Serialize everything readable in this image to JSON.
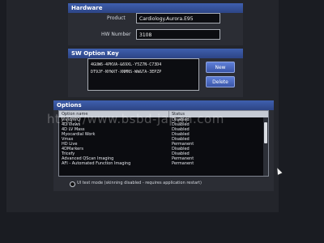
{
  "hardware": {
    "title": "Hardware",
    "product_label": "Product",
    "product_value": "Cardiology.Aurora.E95",
    "hw_number_label": "HW Number",
    "hw_number_value": "3108"
  },
  "sw_option_key": {
    "title": "SW Option Key",
    "keys": [
      "4GUW6-4PKVA-&69XL-Y5Z7N-C73D4",
      "DT9JF-NYWXT-XNMNS-WW&TA-3EPZP"
    ],
    "new_button": "New",
    "delete_button": "Delete"
  },
  "options": {
    "title": "Options",
    "columns": [
      "Option name",
      "Status"
    ],
    "rows": [
      {
        "name": "Vivid/WQ",
        "status": "Disabled"
      },
      {
        "name": "4D Views",
        "status": "Disabled"
      },
      {
        "name": "4D LV Mass",
        "status": "Disabled"
      },
      {
        "name": "Myocardial Work",
        "status": "Disabled"
      },
      {
        "name": "Vmax",
        "status": "Disabled"
      },
      {
        "name": "HD Live",
        "status": "Permanent"
      },
      {
        "name": "4DMarkers",
        "status": "Disabled"
      },
      {
        "name": "Tricefy",
        "status": "Disabled"
      },
      {
        "name": "Advanced QScan Imaging",
        "status": "Permanent"
      },
      {
        "name": "AFI - Automated Function Imaging",
        "status": "Permanent"
      }
    ],
    "ui_test_mode": "UI test mode (skinning disabled - requires application restart)"
  },
  "watermark": "http://www.bsbd-japan.com",
  "colors": {
    "header": "#3f5fae",
    "button": "#4a68bd",
    "background": "#23252b"
  }
}
